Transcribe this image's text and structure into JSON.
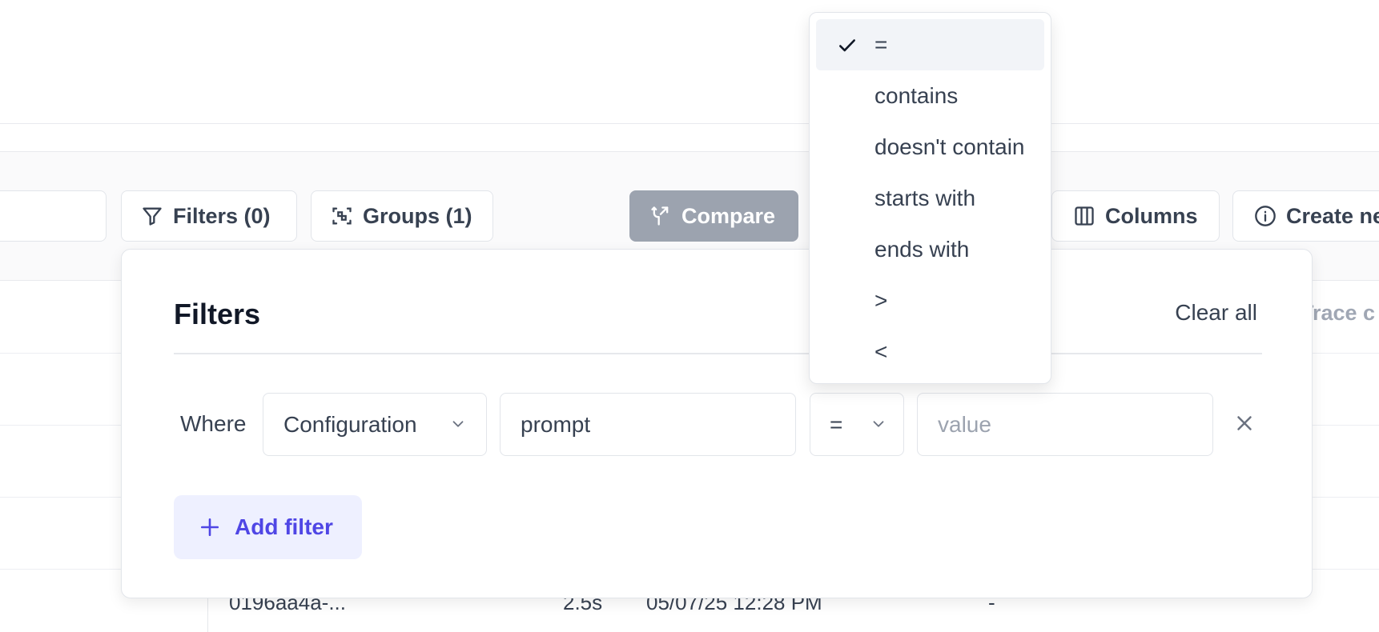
{
  "toolbar": {
    "filters_label": "Filters (0)",
    "groups_label": "Groups (1)",
    "compare_label": "Compare",
    "columns_label": "Columns",
    "create_label": "Create ne",
    "faint_header": "Trace c"
  },
  "table": {
    "visible_row": {
      "id": "0196aa4a-...",
      "duration": "2.5s",
      "timestamp": "05/07/25 12:28 PM",
      "extra": "-"
    }
  },
  "filters_panel": {
    "title": "Filters",
    "clear_all": "Clear all",
    "where_label": "Where",
    "field_select": "Configuration",
    "key_input": "prompt",
    "operator_select": "=",
    "value_placeholder": "value",
    "add_filter": "Add filter"
  },
  "operator_dropdown": {
    "selected": "=",
    "options": [
      {
        "label": "="
      },
      {
        "label": "contains"
      },
      {
        "label": "doesn't contain"
      },
      {
        "label": "starts with"
      },
      {
        "label": "ends with"
      },
      {
        "label": ">"
      },
      {
        "label": "<"
      }
    ]
  },
  "colors": {
    "accent": "#4f46e5",
    "accent_bg": "#eef0ff",
    "compare_bg": "#9ca3af",
    "selected_bg": "#f2f4f8"
  },
  "icons": [
    "filter-icon",
    "groups-icon",
    "compare-icon",
    "columns-icon",
    "info-icon",
    "chevron-down-icon",
    "close-icon",
    "plus-icon",
    "check-icon"
  ]
}
